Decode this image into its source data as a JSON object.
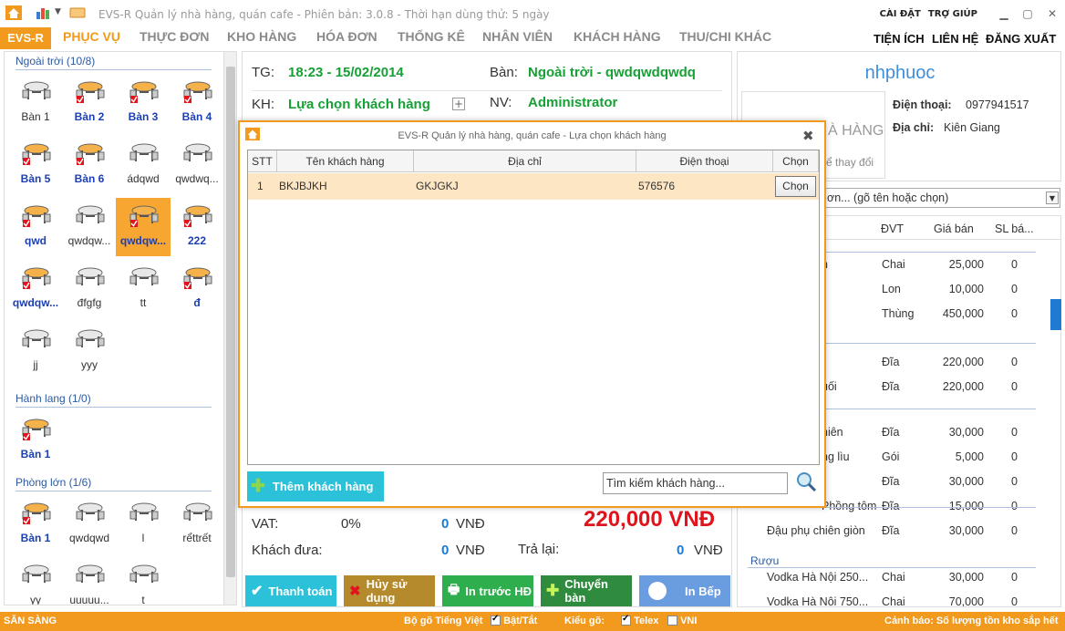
{
  "app": {
    "title": "EVS-R Quản lý nhà hàng, quán cafe - Phiên bản: 3.0.8 - Thời hạn dùng thử: 5 ngày",
    "sys_menu": [
      "CÀI ĐẶT",
      "TRỢ GIÚP"
    ],
    "brand": "EVS-R",
    "tabs": [
      "PHỤC VỤ",
      "THỰC ĐƠN",
      "KHO HÀNG",
      "HÓA ĐƠN",
      "THỐNG KÊ",
      "NHÂN VIÊN",
      "KHÁCH HÀNG",
      "THU/CHI KHÁC"
    ],
    "right_menu": [
      "TIỆN ÍCH",
      "LIÊN HỆ",
      "ĐĂNG XUẤT"
    ]
  },
  "tables": {
    "groups": [
      {
        "name": "Ngoài trời (10/8)",
        "items": [
          {
            "label": "Bàn 1",
            "busy": false
          },
          {
            "label": "Bàn 2",
            "busy": true
          },
          {
            "label": "Bàn 3",
            "busy": true
          },
          {
            "label": "Bàn 4",
            "busy": true
          },
          {
            "label": "Bàn 5",
            "busy": true
          },
          {
            "label": "Bàn 6",
            "busy": true
          },
          {
            "label": "ádqwd",
            "busy": false
          },
          {
            "label": "qwdwq...",
            "busy": false
          },
          {
            "label": "qwd",
            "busy": true
          },
          {
            "label": "qwdqw...",
            "busy": false
          },
          {
            "label": "qwdqw...",
            "busy": true,
            "selected": true
          },
          {
            "label": "222",
            "busy": true
          },
          {
            "label": "qwdqw...",
            "busy": true
          },
          {
            "label": "đfgfg",
            "busy": false
          },
          {
            "label": "tt",
            "busy": false
          },
          {
            "label": "đ",
            "busy": true
          },
          {
            "label": "jj",
            "busy": false
          },
          {
            "label": "yyy",
            "busy": false
          }
        ]
      },
      {
        "name": "Hành lang (1/0)",
        "items": [
          {
            "label": "Bàn 1",
            "busy": true
          }
        ]
      },
      {
        "name": "Phòng lớn (1/6)",
        "items": [
          {
            "label": "Bàn 1",
            "busy": true
          },
          {
            "label": "qwdqwd",
            "busy": false
          },
          {
            "label": "l",
            "busy": false
          },
          {
            "label": "rểttrết",
            "busy": false
          },
          {
            "label": "yy",
            "busy": false
          },
          {
            "label": "uuuuu...",
            "busy": false
          },
          {
            "label": "t",
            "busy": false
          }
        ]
      }
    ]
  },
  "order": {
    "tg_label": "TG:",
    "tg_value": "18:23 - 15/02/2014",
    "ban_label": "Bàn:",
    "ban_value": "Ngoài trời - qwdqwdqwdq",
    "kh_label": "KH:",
    "kh_value": "Lựa chọn khách hàng",
    "nv_label": "NV:",
    "nv_value": "Administrator",
    "vat_label": "VAT:",
    "vat_pct": "0%",
    "vat_value": "0",
    "currency": "VNĐ",
    "total": "220,000 VNĐ",
    "paid_label": "Khách đưa:",
    "paid_value": "0",
    "change_label": "Trả lại:",
    "change_value": "0",
    "buttons": [
      "Thanh toán",
      "Hủy sử dụng",
      "In trước HĐ",
      "Chuyển bàn",
      "In Bếp"
    ]
  },
  "customer": {
    "name": "nhphuoc",
    "phone_label": "Điện thoại:",
    "phone": "0977941517",
    "addr_label": "Địa chỉ:",
    "addr": "Kiên Giang",
    "logo_text": "À HÀNG",
    "logo_hint": "ể thay đổi",
    "search_text": "ơn... (gõ tên hoặc chọn)"
  },
  "menu": {
    "headers": [
      "ĐVT",
      "Giá bán",
      "SL bá..."
    ],
    "rows": [
      {
        "name": "n",
        "unit": "Chai",
        "price": "25,000",
        "qty": "0"
      },
      {
        "name": "",
        "unit": "Lon",
        "price": "10,000",
        "qty": "0"
      },
      {
        "name": "",
        "unit": "Thùng",
        "price": "450,000",
        "qty": "0"
      },
      {
        "name": "",
        "unit": "Đĩa",
        "price": "220,000",
        "qty": "0"
      },
      {
        "name": "uối",
        "unit": "Đĩa",
        "price": "220,000",
        "qty": "0"
      },
      {
        "name": "niên",
        "unit": "Đĩa",
        "price": "30,000",
        "qty": "0"
      },
      {
        "name": "ng lìu",
        "unit": "Gói",
        "price": "5,000",
        "qty": "0"
      },
      {
        "name": "",
        "unit": "Đĩa",
        "price": "30,000",
        "qty": "0"
      },
      {
        "name": "Phồng tôm",
        "unit": "Đĩa",
        "price": "15,000",
        "qty": "0"
      },
      {
        "name": "Đậu phụ chiên giòn",
        "unit": "Đĩa",
        "price": "30,000",
        "qty": "0"
      },
      {
        "name": "Vodka Hà Nội 250...",
        "unit": "Chai",
        "price": "30,000",
        "qty": "0"
      },
      {
        "name": "Vodka Hà Nội 750...",
        "unit": "Chai",
        "price": "70,000",
        "qty": "0"
      }
    ],
    "group_label": "Rượu"
  },
  "dialog": {
    "title": "EVS-R Quản lý nhà hàng, quán cafe - Lựa chọn khách hàng",
    "columns": [
      "STT",
      "Tên khách hàng",
      "Địa chỉ",
      "Điện thoại",
      "Chọn"
    ],
    "rows": [
      {
        "stt": "1",
        "name": "BKJBJKH",
        "address": "GKJGKJ",
        "phone": "576576",
        "action": "Chọn"
      }
    ],
    "add_button": "Thêm khách hàng",
    "search_value": "Tìm kiếm khách hàng..."
  },
  "statusbar": {
    "ready": "SẴN SÀNG",
    "ime_label": "Bộ gõ Tiếng Việt",
    "toggle_label": "Bật/Tắt",
    "type_label": "Kiểu gõ:",
    "telex": "Telex",
    "vni": "VNI",
    "warning": "Cảnh báo: Số lượng tồn kho sắp hết"
  },
  "colors": {
    "accent": "#f29a1d",
    "green": "#16a035",
    "blue": "#1a7ad4",
    "red": "#e0141c"
  }
}
